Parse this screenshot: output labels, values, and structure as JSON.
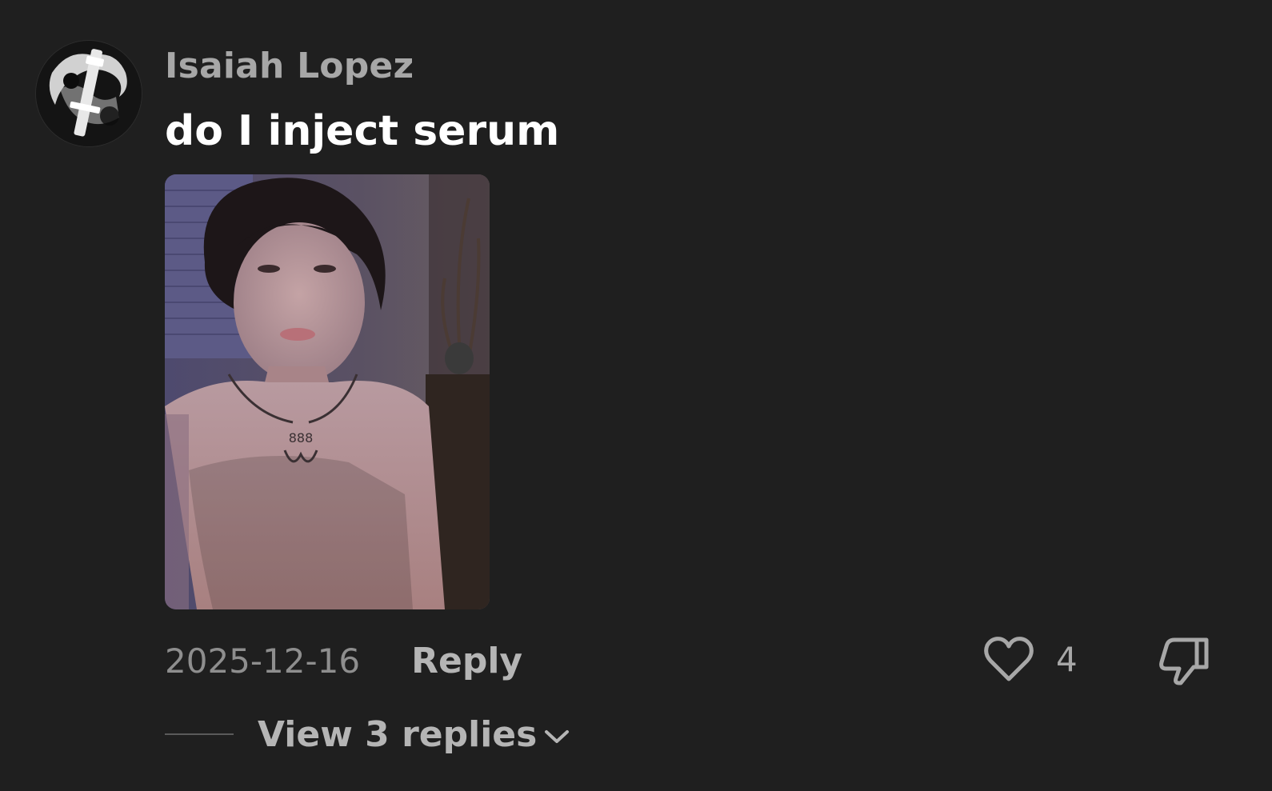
{
  "comment": {
    "author": "Isaiah Lopez",
    "text": "do I inject serum",
    "date": "2025-12-16",
    "reply_label": "Reply",
    "like_count": "4",
    "view_replies_label": "View 3 replies"
  },
  "icons": {
    "like": "heart-outline-icon",
    "dislike": "thumbs-down-outline-icon",
    "expand": "chevron-down-icon"
  },
  "colors": {
    "background": "#1f1f1f",
    "author": "#a7a7a7",
    "text": "#ffffff",
    "muted": "#8e8e8e"
  }
}
